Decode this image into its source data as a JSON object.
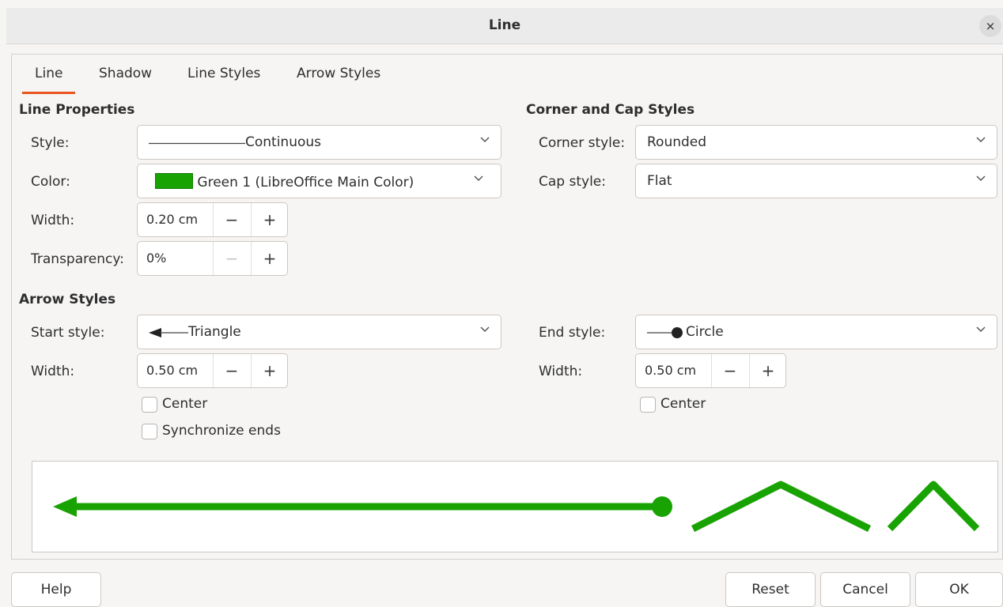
{
  "window": {
    "title": "Line",
    "close_glyph": "×"
  },
  "tabs": [
    "Line",
    "Shadow",
    "Line Styles",
    "Arrow Styles"
  ],
  "line_properties": {
    "title": "Line Properties",
    "style_label": "Style:",
    "style_value": "Continuous",
    "color_label": "Color:",
    "color_value": "Green 1 (LibreOffice Main Color)",
    "color_hex": "#18a303",
    "width_label": "Width:",
    "width_value": "0.20 cm",
    "transparency_label": "Transparency:",
    "transparency_value": "0%"
  },
  "corner_cap": {
    "title": "Corner and Cap Styles",
    "corner_label": "Corner style:",
    "corner_value": "Rounded",
    "cap_label": "Cap style:",
    "cap_value": "Flat"
  },
  "arrow_styles": {
    "title": "Arrow Styles",
    "start_label": "Start style:",
    "start_value": "Triangle",
    "start_width_label": "Width:",
    "start_width_value": "0.50 cm",
    "start_center_label": "Center",
    "sync_label": "Synchronize ends",
    "end_label": "End style:",
    "end_value": "Circle",
    "end_width_label": "Width:",
    "end_width_value": "0.50 cm",
    "end_center_label": "Center"
  },
  "spin_glyphs": {
    "minus": "−",
    "plus": "+"
  },
  "buttons": {
    "help": "Help",
    "reset": "Reset",
    "cancel": "Cancel",
    "ok": "OK"
  },
  "accent_color": "#e95420"
}
